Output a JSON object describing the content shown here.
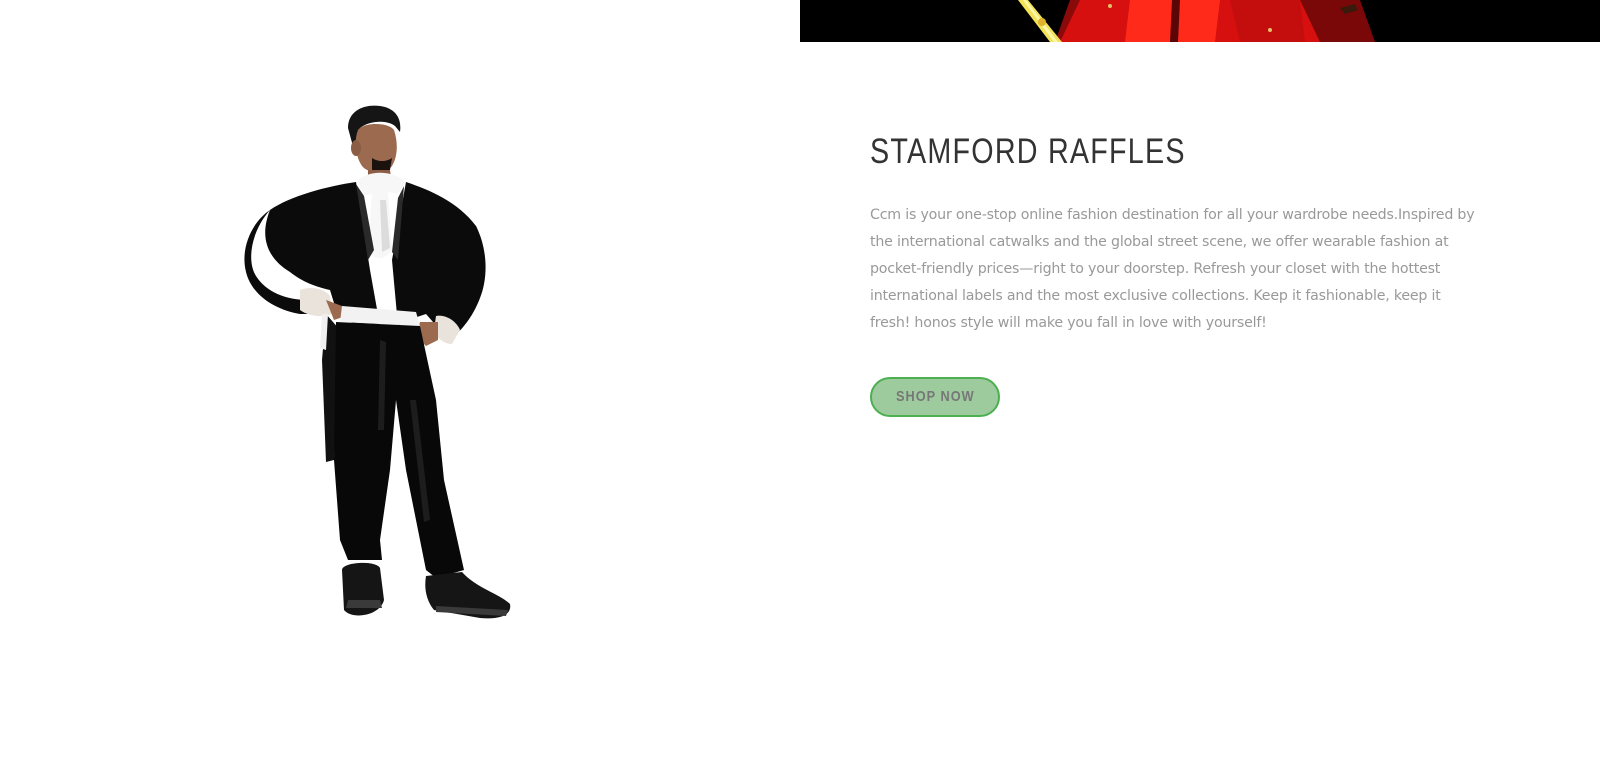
{
  "banner": {
    "image_name": "costumed-performer-red-banner"
  },
  "figure": {
    "image_name": "stamford-raffles-costume-figure"
  },
  "section": {
    "title": "STAMFORD RAFFLES",
    "description": "Ccm is your one-stop online fashion destination for all your wardrobe needs.Inspired by the international catwalks and the global street scene, we offer wearable fashion at pocket-friendly prices—right to your doorstep. Refresh your closet with the hottest international labels and the most exclusive collections. Keep it fashionable, keep it fresh! honos style will make you fall in love with yourself!",
    "cta_label": "SHOP NOW"
  },
  "colors": {
    "cta_background": "#9dcb9e",
    "cta_border": "#4caf50",
    "title": "#333333",
    "body_text": "#999999"
  }
}
